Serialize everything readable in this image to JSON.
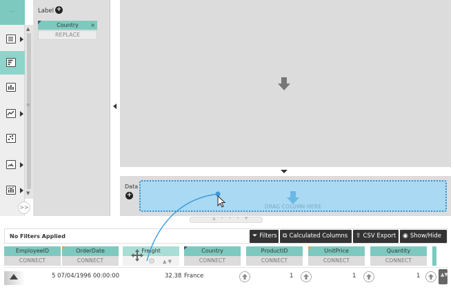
{
  "toolbar": {
    "dots": "...",
    "expand": ">>",
    "items": [
      {
        "name": "table",
        "icon": "table-icon",
        "has_arrow": true,
        "active": false
      },
      {
        "name": "horizontal-bar",
        "icon": "horizontal-bar-chart-icon",
        "has_arrow": false,
        "active": true
      },
      {
        "name": "column",
        "icon": "column-chart-icon",
        "has_arrow": false,
        "active": false
      },
      {
        "name": "line",
        "icon": "line-chart-icon",
        "has_arrow": true,
        "active": false
      },
      {
        "name": "scatter",
        "icon": "scatter-chart-icon",
        "has_arrow": false,
        "active": false
      },
      {
        "name": "gauge",
        "icon": "gauge-chart-icon",
        "has_arrow": true,
        "active": false
      },
      {
        "name": "combo",
        "icon": "combo-chart-icon",
        "has_arrow": true,
        "active": false
      }
    ]
  },
  "label_panel": {
    "title": "Label",
    "add_icon": "plus-circle-icon",
    "chip": {
      "label": "Country",
      "remove": "×"
    },
    "replace_label": "REPLACE"
  },
  "data_panel": {
    "title": "Data",
    "add_icon": "plus-circle-icon",
    "drop_text": "DRAG COLUMN HERE"
  },
  "grid": {
    "filter_status": "No Filters Applied",
    "buttons": {
      "filters": "Filters",
      "calculated_columns": "Calculated Columns",
      "csv_export": "CSV Export",
      "show_hide": "Show/Hide"
    },
    "button_icons": {
      "filters": "funnel-icon",
      "calculated_columns": "copy-icon",
      "csv_export": "export-icon",
      "show_hide": "eye-icon"
    },
    "connect_label": "CONNECT",
    "columns": [
      {
        "name": "EmployeeID"
      },
      {
        "name": "OrderDate"
      },
      {
        "name": "Freight"
      },
      {
        "name": "Country"
      },
      {
        "name": "ProductID"
      },
      {
        "name": "UnitPrice"
      },
      {
        "name": "Quantity"
      }
    ],
    "row": {
      "employee": "5",
      "order_date": "07/04/1996 00:00:00",
      "freight": "32.38",
      "country": "France",
      "product": "1",
      "unit_price": "1",
      "quantity": "1"
    }
  },
  "colors": {
    "accent": "#7dc9bf",
    "dark_button": "#333333",
    "drop_zone": "#a9d9f3",
    "drop_border": "#3f8fc0"
  }
}
